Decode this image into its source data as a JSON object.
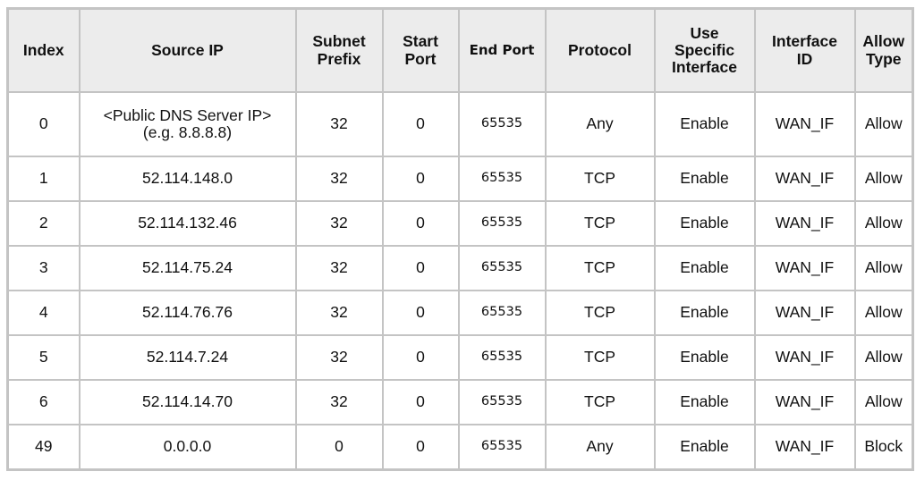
{
  "table": {
    "headers": [
      "Index",
      "Source IP",
      "Subnet\nPrefix",
      "Start\nPort",
      "End Port",
      "Protocol",
      "Use\nSpecific\nInterface",
      "Interface\nID",
      "Allow\nType"
    ],
    "rows": [
      {
        "index": "0",
        "source_ip": "<Public DNS Server IP>",
        "source_ip_note": "(e.g. 8.8.8.8)",
        "subnet_prefix": "32",
        "start_port": "0",
        "end_port": "65535",
        "protocol": "Any",
        "use_specific_interface": "Enable",
        "interface_id": "WAN_IF",
        "allow_type": "Allow"
      },
      {
        "index": "1",
        "source_ip": "52.114.148.0",
        "source_ip_note": "",
        "subnet_prefix": "32",
        "start_port": "0",
        "end_port": "65535",
        "protocol": "TCP",
        "use_specific_interface": "Enable",
        "interface_id": "WAN_IF",
        "allow_type": "Allow"
      },
      {
        "index": "2",
        "source_ip": "52.114.132.46",
        "source_ip_note": "",
        "subnet_prefix": "32",
        "start_port": "0",
        "end_port": "65535",
        "protocol": "TCP",
        "use_specific_interface": "Enable",
        "interface_id": "WAN_IF",
        "allow_type": "Allow"
      },
      {
        "index": "3",
        "source_ip": "52.114.75.24",
        "source_ip_note": "",
        "subnet_prefix": "32",
        "start_port": "0",
        "end_port": "65535",
        "protocol": "TCP",
        "use_specific_interface": "Enable",
        "interface_id": "WAN_IF",
        "allow_type": "Allow"
      },
      {
        "index": "4",
        "source_ip": "52.114.76.76",
        "source_ip_note": "",
        "subnet_prefix": "32",
        "start_port": "0",
        "end_port": "65535",
        "protocol": "TCP",
        "use_specific_interface": "Enable",
        "interface_id": "WAN_IF",
        "allow_type": "Allow"
      },
      {
        "index": "5",
        "source_ip": "52.114.7.24",
        "source_ip_note": "",
        "subnet_prefix": "32",
        "start_port": "0",
        "end_port": "65535",
        "protocol": "TCP",
        "use_specific_interface": "Enable",
        "interface_id": "WAN_IF",
        "allow_type": "Allow"
      },
      {
        "index": "6",
        "source_ip": "52.114.14.70",
        "source_ip_note": "",
        "subnet_prefix": "32",
        "start_port": "0",
        "end_port": "65535",
        "protocol": "TCP",
        "use_specific_interface": "Enable",
        "interface_id": "WAN_IF",
        "allow_type": "Allow"
      },
      {
        "index": "49",
        "source_ip": "0.0.0.0",
        "source_ip_note": "",
        "subnet_prefix": "0",
        "start_port": "0",
        "end_port": "65535",
        "protocol": "Any",
        "use_specific_interface": "Enable",
        "interface_id": "WAN_IF",
        "allow_type": "Block"
      }
    ]
  }
}
